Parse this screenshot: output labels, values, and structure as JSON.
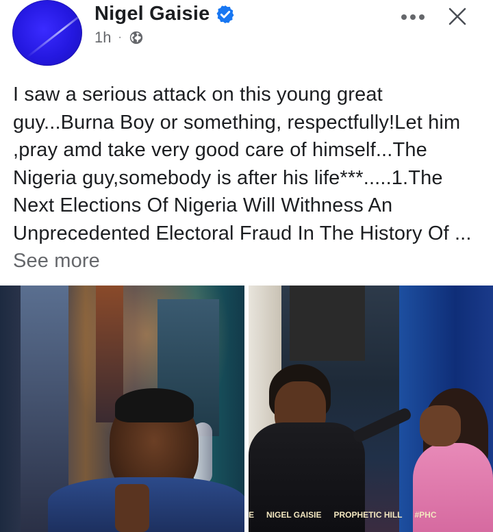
{
  "post": {
    "author": "Nigel Gaisie",
    "time": "1h",
    "separator": "·",
    "text": "I saw a serious attack on this young great guy...Burna Boy or something, respectfully!Let him ,pray amd take very good care of himself...The Nigeria guy,somebody is after his life***.....1.The Next Elections Of Nigeria  Will Withness An Unprecedented Electoral Fraud In The History Of ...",
    "see_more": "See more"
  },
  "photos": {
    "watermarks": [
      "E",
      "NIGEL GAISIE",
      "PROPHETIC HILL",
      "#PHC"
    ]
  },
  "icons": {
    "verified": "verified-badge-icon",
    "audience": "globe-icon",
    "options": "more-options-icon",
    "close": "close-icon"
  },
  "colors": {
    "verified_blue": "#1877f2",
    "meta_gray": "#65676b",
    "text": "#1c1e21",
    "avatar_blue": "#2418e0"
  }
}
